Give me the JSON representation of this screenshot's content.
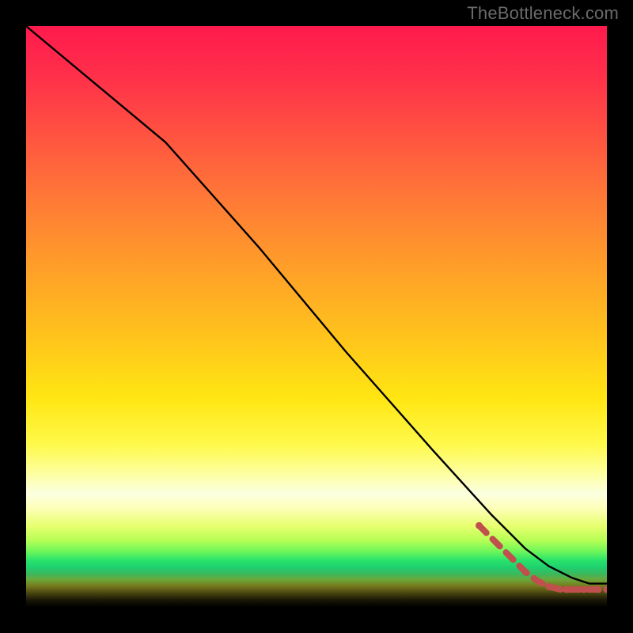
{
  "watermark": "TheBottleneck.com",
  "chart_data": {
    "type": "line",
    "title": "",
    "xlabel": "",
    "ylabel": "",
    "xlim": [
      0,
      100
    ],
    "ylim": [
      0,
      100
    ],
    "grid": false,
    "legend": false,
    "series": [
      {
        "name": "black-curve",
        "color": "#000000",
        "style": "solid",
        "x": [
          0,
          12,
          24,
          40,
          55,
          70,
          80,
          86,
          90,
          94,
          97,
          100
        ],
        "y": [
          100,
          90,
          80,
          62,
          44,
          27,
          16,
          10,
          7,
          5,
          4,
          4
        ]
      },
      {
        "name": "red-dashed-curve",
        "color": "#c0504d",
        "style": "dashed",
        "x": [
          78,
          80,
          82,
          84,
          86,
          88,
          90,
          92,
          94,
          96,
          98,
          100
        ],
        "y": [
          14,
          12,
          10,
          8,
          6,
          4.5,
          3.5,
          3,
          3,
          3,
          3,
          3
        ]
      }
    ],
    "annotations": []
  }
}
